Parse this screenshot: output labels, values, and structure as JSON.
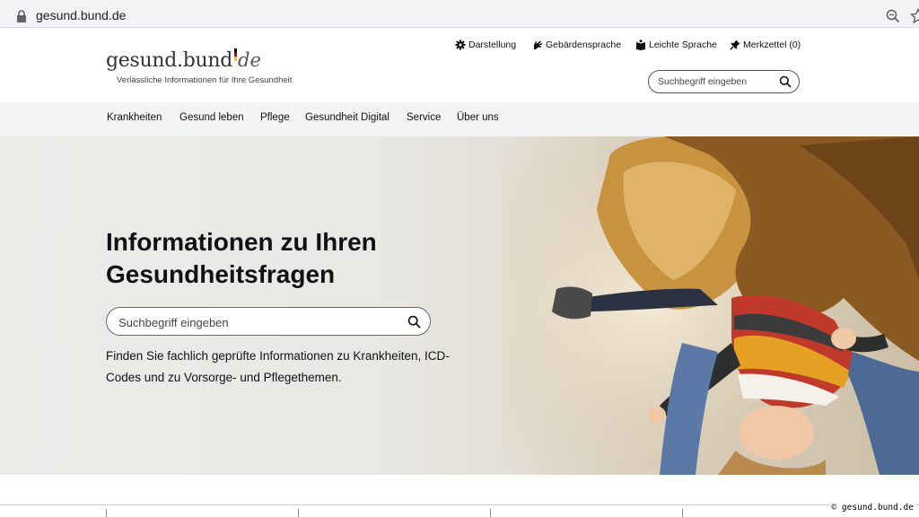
{
  "browser": {
    "url": "gesund.bund.de"
  },
  "logo": {
    "main": "gesund.bund",
    "suffix": "de",
    "tagline": "Verlässliche Informationen für Ihre Gesundheit"
  },
  "utility": [
    {
      "label": "Darstellung",
      "icon": "gear-icon"
    },
    {
      "label": "Gebärdensprache",
      "icon": "sign-language-icon"
    },
    {
      "label": "Leichte Sprache",
      "icon": "book-icon"
    },
    {
      "label": "Merkzettel (0)",
      "icon": "pin-icon"
    }
  ],
  "header_search": {
    "placeholder": "Suchbegriff eingeben"
  },
  "nav": [
    "Krankheiten",
    "Gesund leben",
    "Pflege",
    "Gesundheit Digital",
    "Service",
    "Über uns"
  ],
  "hero": {
    "title": "Informationen zu Ihren Gesundheitsfragen",
    "search_placeholder": "Suchbegriff eingeben",
    "description": "Finden Sie fachlich geprüfte Informationen zu Krankheiten, ICD-Codes und zu Vorsorge- und Pflegethemen."
  },
  "credit": "© gesund.bund.de",
  "colors": {
    "nav_bg": "#f3f4f6",
    "text": "#111111",
    "flag_black": "#000000",
    "flag_red": "#dd0000",
    "flag_gold": "#ffcc00"
  }
}
